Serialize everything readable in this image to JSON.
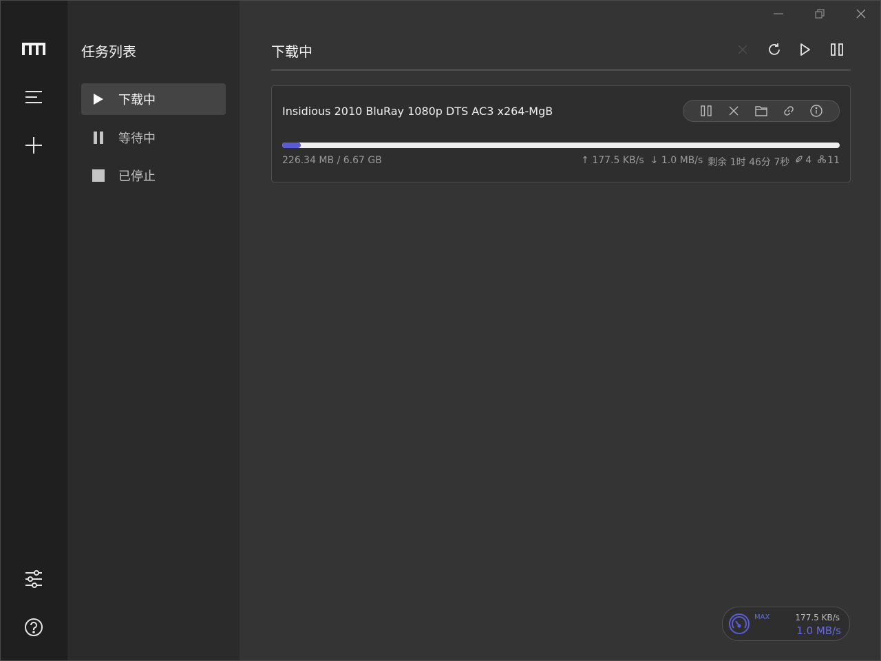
{
  "rail": {
    "logo_icon": "motrix-logo-icon",
    "items": [
      {
        "icon": "menu-icon"
      },
      {
        "icon": "plus-icon"
      },
      {
        "icon": "sliders-icon"
      },
      {
        "icon": "help-icon"
      }
    ]
  },
  "panel": {
    "title": "任务列表",
    "items": [
      {
        "label": "下载中",
        "icon": "play-icon",
        "active": true
      },
      {
        "label": "等待中",
        "icon": "pause-icon",
        "active": false
      },
      {
        "label": "已停止",
        "icon": "stop-icon",
        "active": false
      }
    ]
  },
  "main": {
    "title": "下载中",
    "toolbar": [
      "close-icon",
      "refresh-icon",
      "play-icon",
      "pause-icon"
    ]
  },
  "task": {
    "name": "Insidious 2010 BluRay 1080p DTS AC3 x264-MgB",
    "progress": 0.033,
    "size": "226.34 MB / 6.67 GB",
    "upload": "↑ 177.5 KB/s",
    "download": "↓ 1.0 MB/s",
    "remaining": "剩余 1时 46分 7秒",
    "seeders": "4",
    "peers": "11",
    "actions": [
      "pause-icon",
      "delete-icon",
      "folder-icon",
      "link-icon",
      "info-icon"
    ]
  },
  "speedometer": {
    "max_label": "MAX",
    "upload": "177.5 KB/s",
    "download": "1.0 MB/s"
  },
  "colors": {
    "accent": "#5b5bd6",
    "rail_bg": "#1f1f1f",
    "panel_bg": "#2b2b2b",
    "main_bg": "#343434"
  }
}
